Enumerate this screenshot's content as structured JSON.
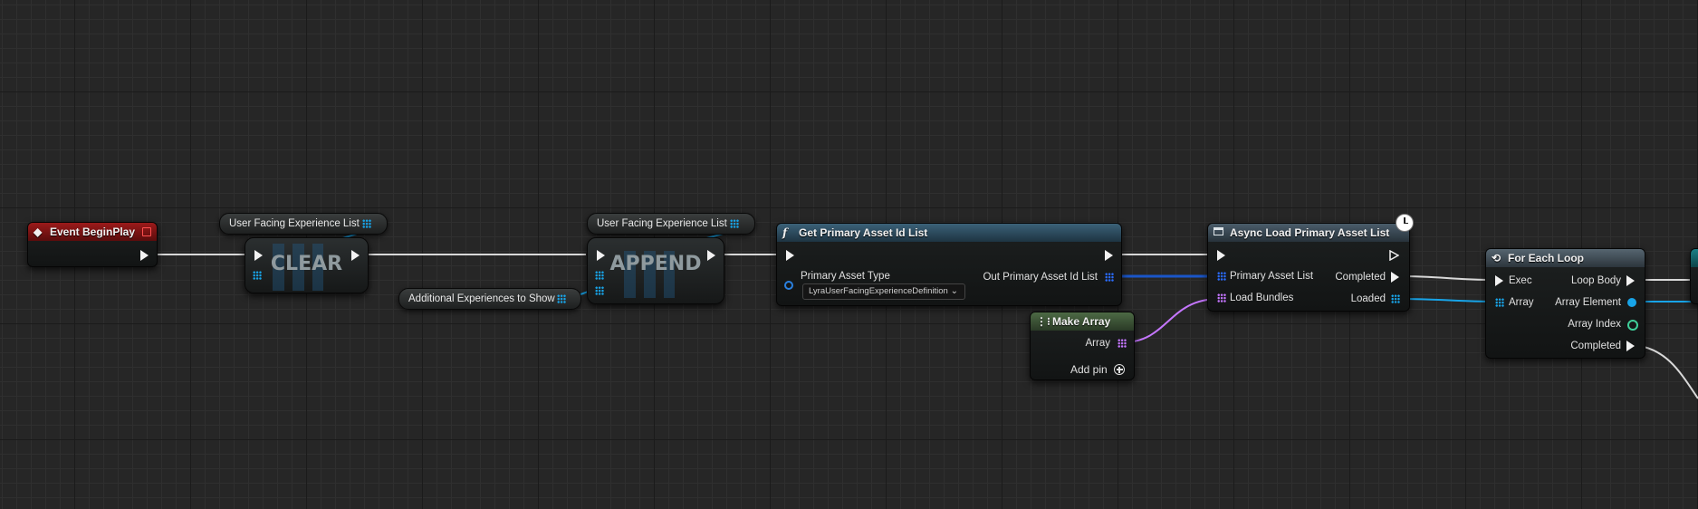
{
  "graph": {
    "event_begin_play": {
      "title": "Event BeginPlay"
    },
    "var_user_facing_1": {
      "label": "User Facing Experience List"
    },
    "var_user_facing_2": {
      "label": "User Facing Experience List"
    },
    "var_additional": {
      "label": "Additional Experiences to Show"
    },
    "clear_node": {
      "title": "CLEAR"
    },
    "append_node": {
      "title": "APPEND"
    },
    "get_primary_asset": {
      "title": "Get Primary Asset Id List",
      "primary_asset_type_label": "Primary Asset Type",
      "primary_asset_type_value": "LyraUserFacingExperienceDefinition",
      "out_label": "Out Primary Asset Id List"
    },
    "async_load": {
      "title": "Async Load Primary Asset List",
      "primary_asset_list_label": "Primary Asset List",
      "load_bundles_label": "Load Bundles",
      "completed_label": "Completed",
      "loaded_label": "Loaded"
    },
    "make_array": {
      "title": "Make Array",
      "array_label": "Array",
      "add_pin_label": "Add pin"
    },
    "for_each_loop": {
      "title": "For Each Loop",
      "exec_label": "Exec",
      "array_label": "Array",
      "loop_body_label": "Loop Body",
      "array_element_label": "Array Element",
      "array_index_label": "Array Index",
      "completed_label": "Completed"
    }
  },
  "colors": {
    "event_header": "#8a1414",
    "function_header": "#2e4a5c",
    "async_header": "#3b4a55",
    "make_array_header": "#3d5437",
    "loop_header": "#3e4a55",
    "exec_wire": "#e8e8e8",
    "array_pin_blue": "#18a4e8",
    "array_pin_purple": "#c576ff",
    "dark_blue_wire": "#1a55c8"
  },
  "icons": {
    "event": "event-diamond-icon",
    "function": "function-f-icon",
    "async": "async-window-icon",
    "make_array": "make-array-icon",
    "loop": "loop-arrows-icon",
    "latent": "clock-icon"
  }
}
